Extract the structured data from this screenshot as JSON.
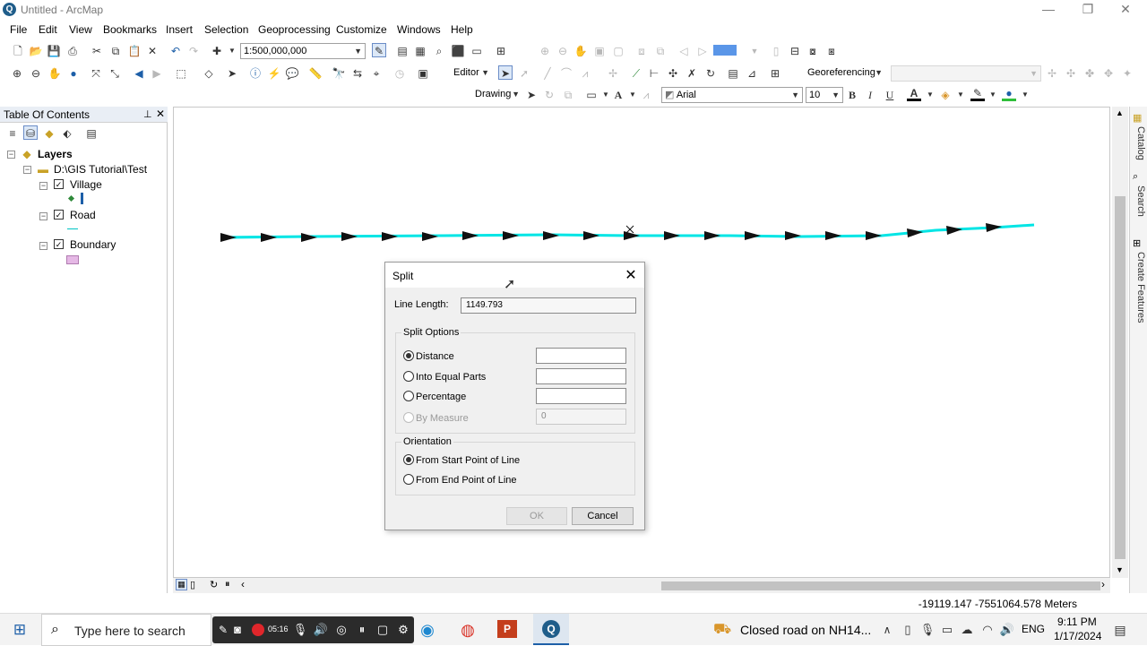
{
  "window": {
    "title": "Untitled - ArcMap",
    "app_icon": "globe-icon",
    "controls": [
      "minimize-icon",
      "restore-icon",
      "close-icon"
    ]
  },
  "menubar": [
    "File",
    "Edit",
    "View",
    "Bookmarks",
    "Insert",
    "Selection",
    "Geoprocessing",
    "Customize",
    "Windows",
    "Help"
  ],
  "toolbar": {
    "scale": "1:500,000,000",
    "editor_label": "Editor",
    "georeferencing_label": "Georeferencing",
    "drawing_label": "Drawing",
    "font_name": "Arial",
    "font_size": "10",
    "bold": "B",
    "italic": "I",
    "underline": "U",
    "text_color_label": "A"
  },
  "toc": {
    "title": "Table Of Contents",
    "root": "Layers",
    "folder": "D:\\GIS Tutorial\\Test",
    "layers": [
      {
        "name": "Village",
        "checked": true,
        "symbol": "point",
        "color": "#2f8a3a"
      },
      {
        "name": "Road",
        "checked": true,
        "symbol": "line",
        "color": "#00c4c4"
      },
      {
        "name": "Boundary",
        "checked": true,
        "symbol": "polygon",
        "color": "#e5b8e5"
      }
    ]
  },
  "map": {
    "road_color": "#00e5e5",
    "arrow_color": "#111111"
  },
  "side_tabs": [
    "Catalog",
    "Search",
    "Create Features"
  ],
  "dialog": {
    "title": "Split",
    "line_length_label": "Line Length:",
    "line_length_value": "1149.793",
    "split_options_label": "Split Options",
    "options": [
      {
        "label": "Distance",
        "checked": true,
        "enabled": true,
        "value": ""
      },
      {
        "label": "Into Equal Parts",
        "checked": false,
        "enabled": true,
        "value": ""
      },
      {
        "label": "Percentage",
        "checked": false,
        "enabled": true,
        "value": ""
      },
      {
        "label": "By Measure",
        "checked": false,
        "enabled": false,
        "value": "0"
      }
    ],
    "orientation_label": "Orientation",
    "orientation_options": [
      {
        "label": "From Start Point of Line",
        "checked": true
      },
      {
        "label": "From End Point of Line",
        "checked": false
      }
    ],
    "ok_label": "OK",
    "cancel_label": "Cancel"
  },
  "status": {
    "coordinates": "-19119.147  -7551064.578 Meters"
  },
  "taskbar": {
    "search_placeholder": "Type here to search",
    "recording_time": "05:16",
    "news": "Closed road on NH14...",
    "language": "ENG",
    "time": "9:11 PM",
    "date": "1/17/2024"
  }
}
